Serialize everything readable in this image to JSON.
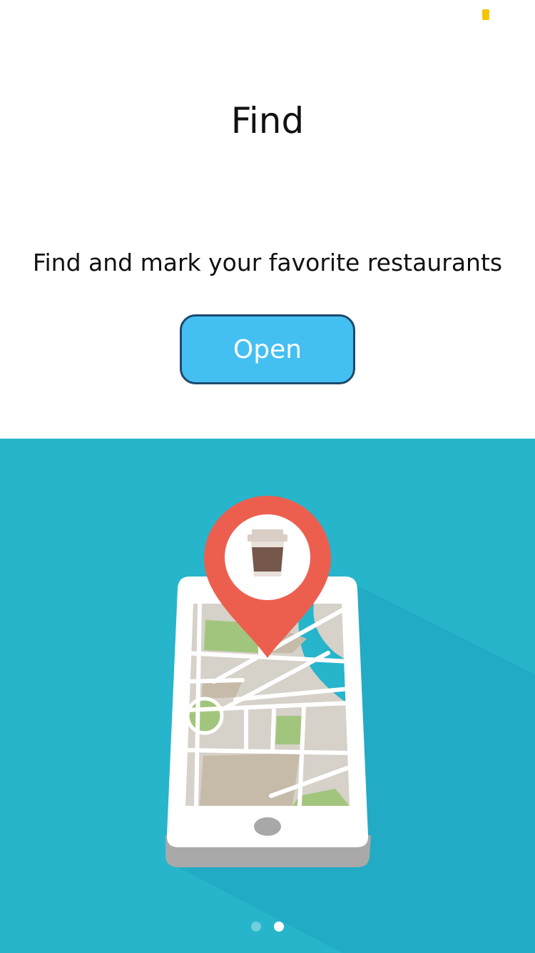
{
  "screen": {
    "title": "Find",
    "subtitle": "Find and mark your favorite restaurants",
    "open_button_label": "Open"
  },
  "status_indicator_color": "#f5c400",
  "colors": {
    "illustration_background": "#27b5cc",
    "button_fill": "#44bff2",
    "button_border": "#1d4a6e",
    "pin": "#ec5f4f"
  },
  "illustration": {
    "icons": [
      "smartphone-icon",
      "map-icon",
      "location-pin-icon",
      "coffee-cup-icon"
    ]
  },
  "pagination": {
    "total": 2,
    "active_index": 1
  }
}
